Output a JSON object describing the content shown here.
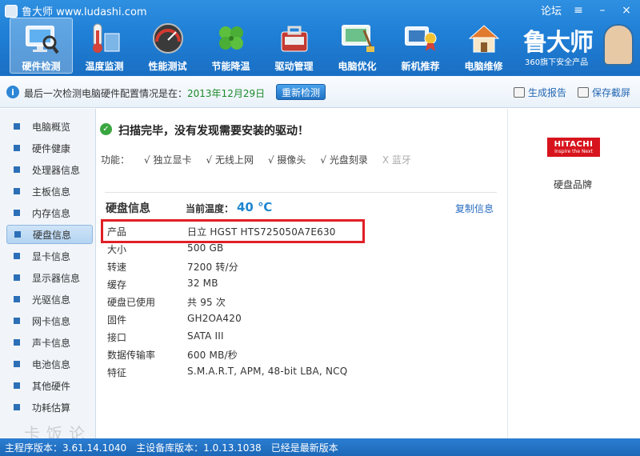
{
  "window": {
    "title": "鲁大师 www.ludashi.com",
    "forum_label": "论坛",
    "minimize": "–",
    "close": "×"
  },
  "nav": {
    "items": [
      {
        "label": "硬件检测",
        "icon": "monitor-magnifier-icon",
        "color": "#4a9fe8"
      },
      {
        "label": "温度监测",
        "icon": "thermometer-icon",
        "color": "#d4433a"
      },
      {
        "label": "性能测试",
        "icon": "speedometer-icon",
        "color": "#b73a34"
      },
      {
        "label": "节能降温",
        "icon": "clover-icon",
        "color": "#4caf3a"
      },
      {
        "label": "驱动管理",
        "icon": "toolbox-icon",
        "color": "#c43b33"
      },
      {
        "label": "电脑优化",
        "icon": "screen-broom-icon",
        "color": "#3c9c5b"
      },
      {
        "label": "新机推荐",
        "icon": "computer-award-icon",
        "color": "#3b7cc0"
      },
      {
        "label": "电脑维修",
        "icon": "house-icon",
        "color": "#e07a2e"
      }
    ]
  },
  "brand": {
    "name": "鲁大师",
    "subtitle": "360旗下安全产品"
  },
  "status": {
    "text": "最后一次检测电脑硬件配置情况是在：",
    "date": "2013年12月29日",
    "recheck_button": "重新检测",
    "report_button": "生成报告",
    "screenshot_button": "保存截屏"
  },
  "sidebar": {
    "items": [
      {
        "label": "电脑概览"
      },
      {
        "label": "硬件健康"
      },
      {
        "label": "处理器信息"
      },
      {
        "label": "主板信息"
      },
      {
        "label": "内存信息"
      },
      {
        "label": "硬盘信息"
      },
      {
        "label": "显卡信息"
      },
      {
        "label": "显示器信息"
      },
      {
        "label": "光驱信息"
      },
      {
        "label": "网卡信息"
      },
      {
        "label": "声卡信息"
      },
      {
        "label": "电池信息"
      },
      {
        "label": "其他硬件"
      },
      {
        "label": "功耗估算"
      }
    ],
    "active_index": 5,
    "watermark": "卡饭论坛"
  },
  "main": {
    "scan_message": "扫描完毕，没有发现需要安装的驱动！",
    "features_label": "功能：",
    "features": [
      {
        "label": "√ 独立显卡",
        "enabled": true
      },
      {
        "label": "√ 无线上网",
        "enabled": true
      },
      {
        "label": "√ 摄像头",
        "enabled": true
      },
      {
        "label": "√ 光盘刻录",
        "enabled": true
      },
      {
        "label": "X 蓝牙",
        "enabled": false
      }
    ],
    "disk_title": "硬盘信息",
    "temp_label": "当前温度：",
    "temp_value": "40 ℃",
    "copy_link": "复制信息",
    "rows": [
      {
        "label": "产品",
        "value": "日立 HGST HTS725050A7E630"
      },
      {
        "label": "大小",
        "value": "500 GB"
      },
      {
        "label": "转速",
        "value": "7200 转/分"
      },
      {
        "label": "缓存",
        "value": "32 MB"
      },
      {
        "label": "硬盘已使用",
        "value": "共 95 次"
      },
      {
        "label": "固件",
        "value": "GH2OA420"
      },
      {
        "label": "接口",
        "value": "SATA III"
      },
      {
        "label": "数据传输率",
        "value": "600 MB/秒"
      },
      {
        "label": "特征",
        "value": "S.M.A.R.T,  APM,  48-bit LBA,  NCQ"
      }
    ]
  },
  "right_panel": {
    "logo_main": "HITACHI",
    "logo_tagline": "Inspire the Next",
    "brand_label": "硬盘品牌"
  },
  "footer": {
    "main_version": "主程序版本：3.61.14.1040",
    "db_version": "主设备库版本：1.0.13.1038",
    "status": "已经是最新版本"
  }
}
